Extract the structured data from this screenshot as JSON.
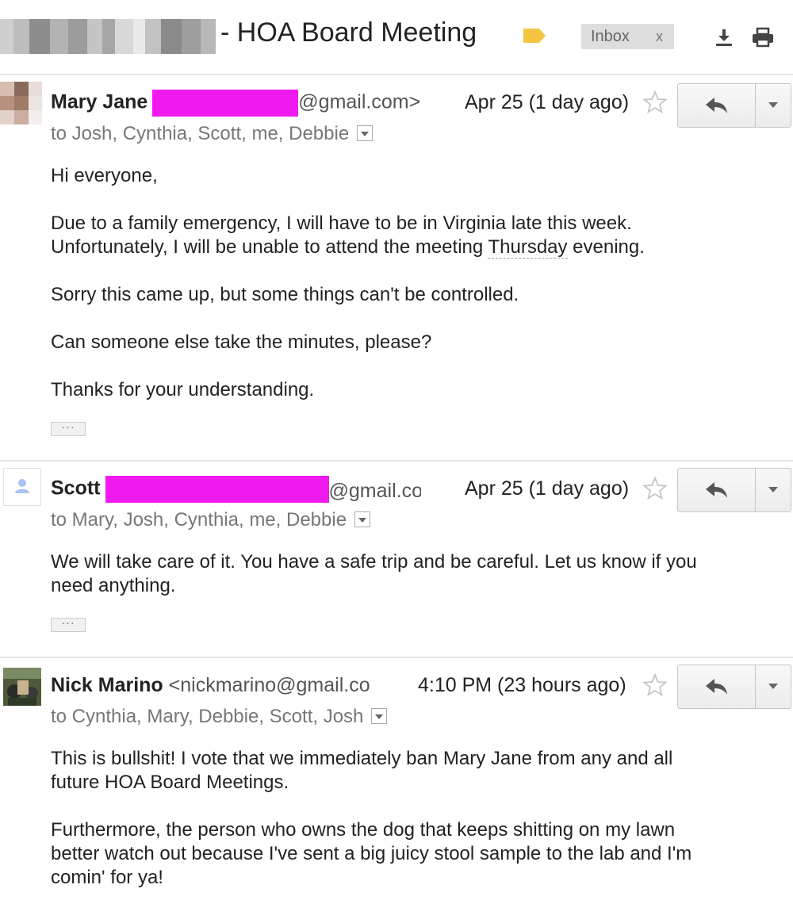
{
  "thread": {
    "subject": "- HOA Board Meeting",
    "label": "Inbox",
    "label_remove": "x",
    "icons": {
      "label_tag": "label-tag-icon",
      "download": "download-icon",
      "print": "print-icon"
    },
    "colors": {
      "label_tag": "#f4c542",
      "redaction": "#f01af0"
    }
  },
  "messages": [
    {
      "sender_name": "Mary Jane",
      "sender_email": "@gmail.com>",
      "date": "Apr 25 (1 day ago)",
      "recipients": "to Josh, Cynthia, Scott, me, Debbie",
      "body": {
        "p1": "Hi everyone,",
        "p2a": "Due to a family emergency, I will have to be in Virginia late this week.",
        "p2b_pre": "Unfortunately, I will be unable to attend the meeting ",
        "p2b_day": "Thursday",
        "p2b_post": " evening.",
        "p3": "Sorry this came up, but some things can't be controlled.",
        "p4": "Can someone else take the minutes, please?",
        "p5": "Thanks for your understanding."
      },
      "ellipsis": "···"
    },
    {
      "sender_name": "Scott",
      "sender_email": "@gmail.co",
      "date": "Apr 25 (1 day ago)",
      "recipients": "to Mary, Josh, Cynthia, me, Debbie",
      "body": {
        "p1a": "We will take care of it.  You have a safe trip and be careful.  Let us know if you",
        "p1b": "need anything."
      },
      "ellipsis": "···"
    },
    {
      "sender_name": "Nick Marino",
      "sender_email": "<nickmarino@gmail.co",
      "date": "4:10 PM (23 hours ago)",
      "recipients": "to Cynthia, Mary, Debbie, Scott, Josh",
      "body": {
        "p1a": "This is bullshit!  I vote that we immediately ban Mary Jane from any and all",
        "p1b": "future HOA Board Meetings.",
        "p2a": "Furthermore, the person who owns the dog that keeps shitting on my lawn",
        "p2b": "better watch out because I've sent a big juicy stool sample to the lab and I'm",
        "p2c": "comin' for ya!"
      }
    }
  ]
}
